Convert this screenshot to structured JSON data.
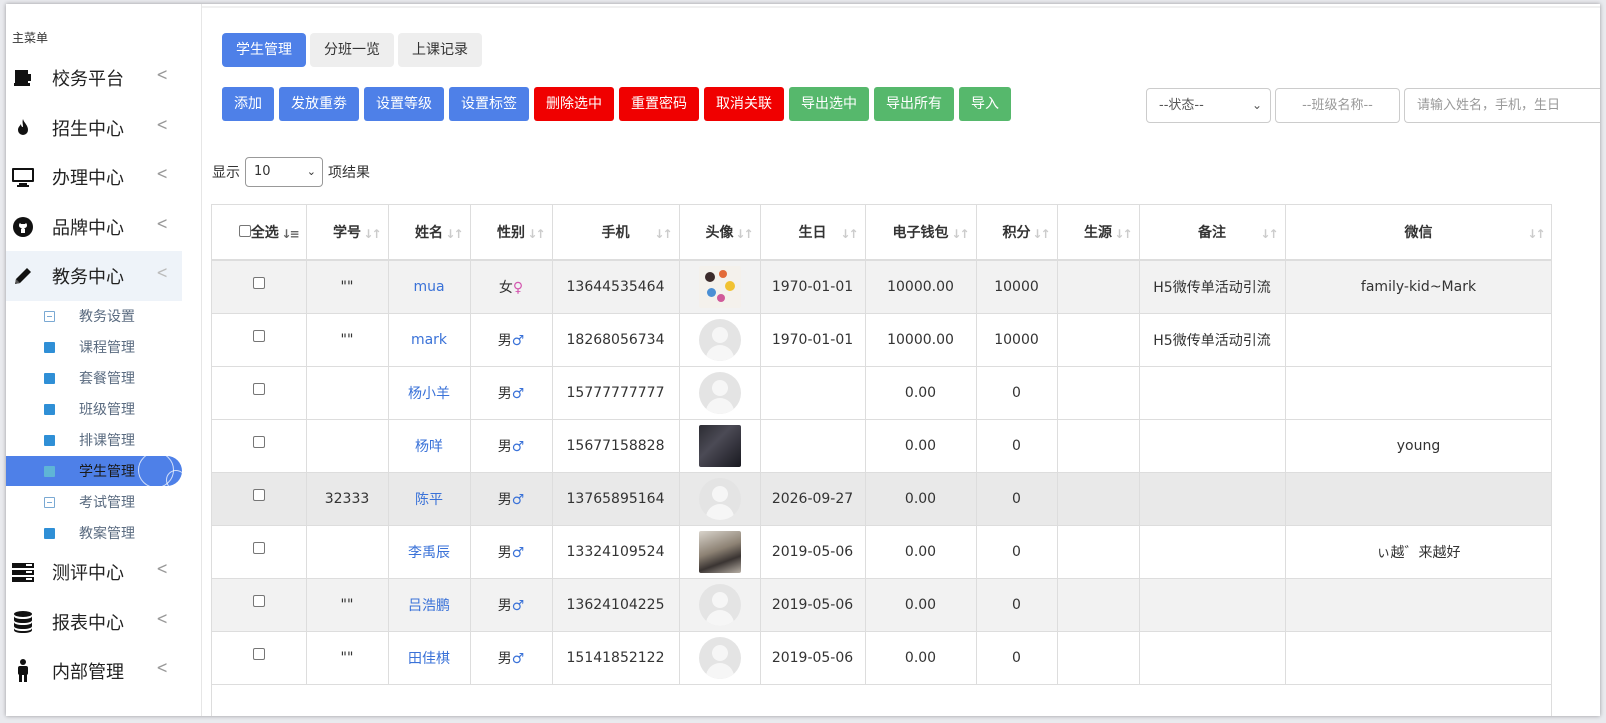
{
  "sidebar": {
    "title": "主菜单",
    "menus": [
      {
        "label": "校务平台",
        "icon": "cup-icon"
      },
      {
        "label": "招生中心",
        "icon": "fire-icon"
      },
      {
        "label": "办理中心",
        "icon": "monitor-icon"
      },
      {
        "label": "品牌中心",
        "icon": "github-icon"
      },
      {
        "label": "教务中心",
        "icon": "pencil-icon"
      },
      {
        "label": "测评中心",
        "icon": "server-icon"
      },
      {
        "label": "报表中心",
        "icon": "database-icon"
      },
      {
        "label": "内部管理",
        "icon": "person-icon"
      }
    ],
    "sub_items": [
      {
        "label": "教务设置"
      },
      {
        "label": "课程管理"
      },
      {
        "label": "套餐管理"
      },
      {
        "label": "班级管理"
      },
      {
        "label": "排课管理"
      },
      {
        "label": "学生管理"
      },
      {
        "label": "考试管理"
      },
      {
        "label": "教案管理"
      }
    ]
  },
  "tabs": [
    {
      "label": "学生管理"
    },
    {
      "label": "分班一览"
    },
    {
      "label": "上课记录"
    }
  ],
  "actions": [
    {
      "label": "添加"
    },
    {
      "label": "发放重劵"
    },
    {
      "label": "设置等级"
    },
    {
      "label": "设置标签"
    },
    {
      "label": "删除选中"
    },
    {
      "label": "重置密码"
    },
    {
      "label": "取消关联"
    },
    {
      "label": "导出选中"
    },
    {
      "label": "导出所有"
    },
    {
      "label": "导入"
    }
  ],
  "filters": {
    "status_value": "--状态--",
    "class_placeholder": "--班级名称--",
    "search_placeholder": "请输入姓名，手机，生日"
  },
  "page_size": {
    "prefix": "显示",
    "value": "10",
    "suffix": "项结果"
  },
  "table": {
    "select_all_label": "全选",
    "columns": [
      "学号",
      "姓名",
      "性别",
      "手机",
      "头像",
      "生日",
      "电子钱包",
      "积分",
      "生源",
      "备注",
      "微信"
    ],
    "rows": [
      {
        "id": "\"\"",
        "name": "mua",
        "gender": "女♀",
        "phone": "13644535464",
        "avatar": "photo-cartoon",
        "birthday": "1970-01-01",
        "wallet": "10000.00",
        "points": "10000",
        "source": "",
        "note": "H5微传单活动引流",
        "wechat": "family-kid~Mark"
      },
      {
        "id": "\"\"",
        "name": "mark",
        "gender": "男♂",
        "phone": "18268056734",
        "avatar": "default",
        "birthday": "1970-01-01",
        "wallet": "10000.00",
        "points": "10000",
        "source": "",
        "note": "H5微传单活动引流",
        "wechat": ""
      },
      {
        "id": "",
        "name": "杨小羊",
        "gender": "男♂",
        "phone": "15777777777",
        "avatar": "default",
        "birthday": "",
        "wallet": "0.00",
        "points": "0",
        "source": "",
        "note": "",
        "wechat": ""
      },
      {
        "id": "",
        "name": "杨咩",
        "gender": "男♂",
        "phone": "15677158828",
        "avatar": "photo-dark",
        "birthday": "",
        "wallet": "0.00",
        "points": "0",
        "source": "",
        "note": "",
        "wechat": "young"
      },
      {
        "id": "32333",
        "name": "陈平",
        "gender": "男♂",
        "phone": "13765895164",
        "avatar": "default",
        "birthday": "2026-09-27",
        "wallet": "0.00",
        "points": "0",
        "source": "",
        "note": "",
        "wechat": ""
      },
      {
        "id": "",
        "name": "李禹辰",
        "gender": "男♂",
        "phone": "13324109524",
        "avatar": "photo-room",
        "birthday": "2019-05-06",
        "wallet": "0.00",
        "points": "0",
        "source": "",
        "note": "",
        "wechat": "ぃ越゛来越好"
      },
      {
        "id": "\"\"",
        "name": "吕浩鹏",
        "gender": "男♂",
        "phone": "13624104225",
        "avatar": "default",
        "birthday": "2019-05-06",
        "wallet": "0.00",
        "points": "0",
        "source": "",
        "note": "",
        "wechat": ""
      },
      {
        "id": "\"\"",
        "name": "田佳棋",
        "gender": "男♂",
        "phone": "15141852122",
        "avatar": "default",
        "birthday": "2019-05-06",
        "wallet": "0.00",
        "points": "0",
        "source": "",
        "note": "",
        "wechat": ""
      }
    ]
  },
  "colors": {
    "primary": "#4e80e8",
    "danger": "#f00000",
    "success": "#56b86c",
    "link": "#3a72d8"
  }
}
